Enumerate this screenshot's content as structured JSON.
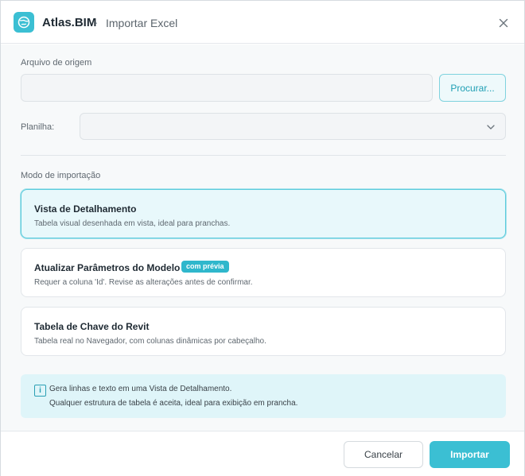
{
  "header": {
    "app_name": "Atlas.BIM",
    "separator": "·",
    "title": "Importar Excel",
    "logo_icon": "globe-icon",
    "close_icon": "close-icon"
  },
  "source": {
    "label": "Arquivo de origem",
    "file_value": "",
    "browse_label": "Procurar..."
  },
  "sheet": {
    "label": "Planilha:",
    "value": "",
    "chevron_icon": "chevron-down-icon"
  },
  "mode": {
    "label": "Modo de importação",
    "options": [
      {
        "title": "Vista de Detalhamento",
        "description": "Tabela visual desenhada em vista, ideal para pranchas.",
        "selected": true
      },
      {
        "title": "Atualizar Parâmetros do Modelo",
        "badge": "com prévia",
        "description": "Requer a coluna 'Id'. Revise as alterações antes de confirmar.",
        "selected": false
      },
      {
        "title": "Tabela de Chave do Revit",
        "description": "Tabela real no Navegador, com colunas dinâmicas por cabeçalho.",
        "selected": false
      }
    ]
  },
  "info": {
    "icon": "info-icon",
    "line1": "Gera linhas e texto em uma Vista de Detalhamento.",
    "line2": "Qualquer estrutura de tabela é aceita, ideal para exibição em prancha."
  },
  "footer": {
    "cancel_label": "Cancelar",
    "import_label": "Importar"
  },
  "colors": {
    "accent": "#3bbfd3",
    "selected_card_bg": "#e8f8fb",
    "info_bg": "#dff5f9"
  }
}
